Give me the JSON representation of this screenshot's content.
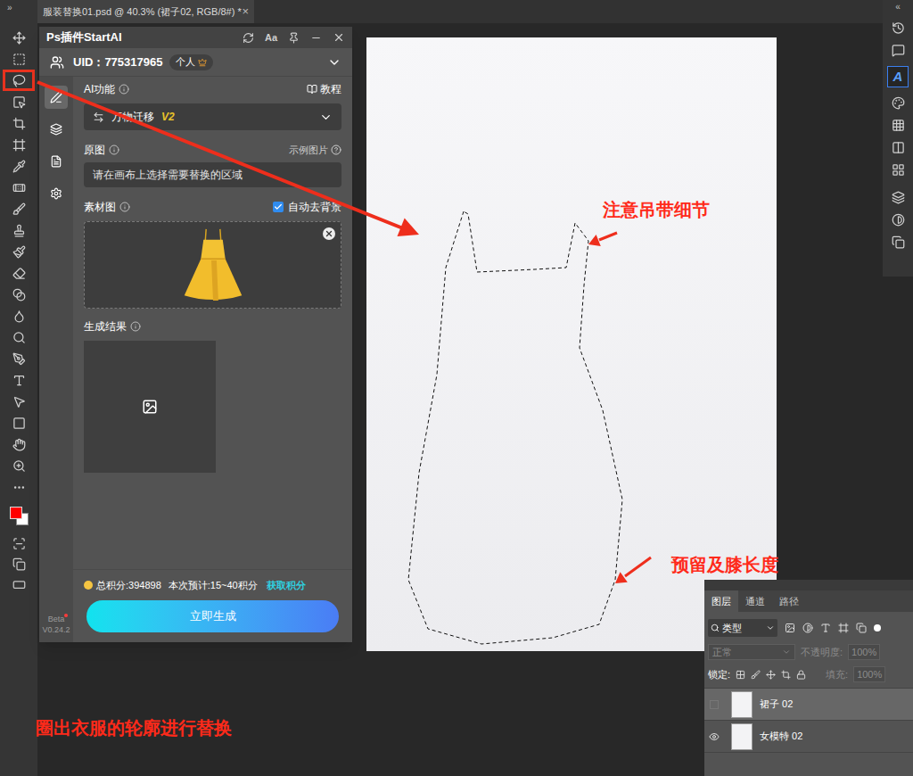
{
  "document_tab": {
    "title": "服装替换01.psd @ 40.3% (裙子02, RGB/8#) *",
    "close": "×"
  },
  "toolbar": {
    "collapse": "»",
    "tools": [
      {
        "selected": false
      },
      {
        "selected": false
      },
      {
        "selected": true
      },
      {
        "selected": false
      },
      {
        "selected": false
      },
      {
        "selected": false
      },
      {
        "selected": false
      },
      {
        "selected": false
      },
      {
        "selected": false
      },
      {
        "selected": false
      },
      {
        "selected": false
      },
      {
        "selected": false
      },
      {
        "selected": false
      },
      {
        "selected": false
      },
      {
        "selected": false
      },
      {
        "selected": false
      },
      {
        "selected": false
      },
      {
        "selected": false
      },
      {
        "selected": false
      },
      {
        "selected": false
      },
      {
        "selected": false
      },
      {
        "selected": false
      }
    ],
    "colors": {
      "foreground": "#ff0000",
      "background": "#ffffff"
    }
  },
  "right_strip": {
    "collapse": "«",
    "logo": "A"
  },
  "plugin": {
    "title": "Ps插件StartAI",
    "font_button": "Aa",
    "uid": "UID：775317965",
    "account": "个人",
    "nav": [
      {
        "selected": true
      },
      {
        "selected": false
      },
      {
        "selected": false
      },
      {
        "selected": false
      }
    ],
    "feature_label": "AI功能",
    "tutorial": "教程",
    "feature": "万物迁移",
    "feature_version": "V2",
    "source_label": "原图",
    "example_link": "示例图片",
    "source_placeholder": "请在画布上选择需要替换的区域",
    "material_label": "素材图",
    "auto_remove_bg": {
      "label": "自动去背景",
      "checked": true
    },
    "result_label": "生成结果",
    "total_points": "总积分:394898",
    "estimate": "本次预计:15~40积分",
    "get_points": "获取积分",
    "generate_button": "立即生成",
    "beta": "Beta",
    "version": "V0.24.2"
  },
  "annotations": [
    {
      "text": "注意吊带细节"
    },
    {
      "text": "预留及膝长度"
    }
  ],
  "caption": "圈出衣服的轮廓进行替换",
  "layers_panel": {
    "tabs": [
      {
        "label": "图层",
        "selected": true
      },
      {
        "label": "通道",
        "selected": false
      },
      {
        "label": "路径",
        "selected": false
      }
    ],
    "filter": "类型",
    "blend": {
      "value": "正常",
      "disabled": true
    },
    "opacity": {
      "label": "不透明度:",
      "value": "100%",
      "disabled": true
    },
    "lock_label": "锁定:",
    "fill": {
      "label": "填充:",
      "value": "100%",
      "disabled": true
    },
    "layers": [
      {
        "name": "裙子 02",
        "visible": false,
        "selected": true
      },
      {
        "name": "女模特 02",
        "visible": true,
        "selected": false
      }
    ]
  }
}
